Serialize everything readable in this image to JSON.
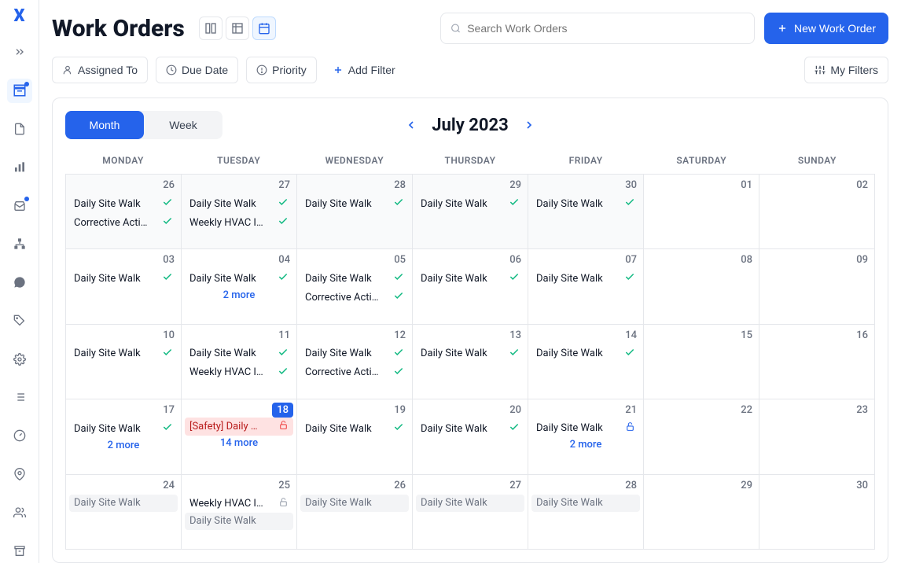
{
  "page": {
    "title": "Work Orders",
    "search_placeholder": "Search Work Orders",
    "new_button": "New Work Order"
  },
  "filters": {
    "assigned_to": "Assigned To",
    "due_date": "Due Date",
    "priority": "Priority",
    "add_filter": "Add Filter",
    "my_filters": "My Filters"
  },
  "calendar_ctrl": {
    "month_tab": "Month",
    "week_tab": "Week",
    "label": "July 2023",
    "days": [
      "MONDAY",
      "TUESDAY",
      "WEDNESDAY",
      "THURSDAY",
      "FRIDAY",
      "SATURDAY",
      "SUNDAY"
    ]
  },
  "cells": [
    {
      "date": "26",
      "outside": true,
      "events": [
        {
          "t": "Daily Site Walk",
          "s": "check"
        },
        {
          "t": "Corrective Acti…",
          "s": "check"
        }
      ]
    },
    {
      "date": "27",
      "outside": true,
      "events": [
        {
          "t": "Daily Site Walk",
          "s": "check"
        },
        {
          "t": "Weekly HVAC I…",
          "s": "check"
        }
      ]
    },
    {
      "date": "28",
      "outside": true,
      "events": [
        {
          "t": "Daily Site Walk",
          "s": "check"
        }
      ]
    },
    {
      "date": "29",
      "outside": true,
      "events": [
        {
          "t": "Daily Site Walk",
          "s": "check"
        }
      ]
    },
    {
      "date": "30",
      "outside": true,
      "events": [
        {
          "t": "Daily Site Walk",
          "s": "check"
        }
      ]
    },
    {
      "date": "01",
      "outside": false,
      "events": []
    },
    {
      "date": "02",
      "outside": false,
      "events": []
    },
    {
      "date": "03",
      "outside": false,
      "events": [
        {
          "t": "Daily Site Walk",
          "s": "check"
        }
      ]
    },
    {
      "date": "04",
      "outside": false,
      "events": [
        {
          "t": "Daily Site Walk",
          "s": "check"
        }
      ],
      "more": "2 more"
    },
    {
      "date": "05",
      "outside": false,
      "events": [
        {
          "t": "Daily Site Walk",
          "s": "check"
        },
        {
          "t": "Corrective Acti…",
          "s": "check"
        }
      ]
    },
    {
      "date": "06",
      "outside": false,
      "events": [
        {
          "t": "Daily Site Walk",
          "s": "check"
        }
      ]
    },
    {
      "date": "07",
      "outside": false,
      "events": [
        {
          "t": "Daily Site Walk",
          "s": "check"
        }
      ]
    },
    {
      "date": "08",
      "outside": false,
      "events": []
    },
    {
      "date": "09",
      "outside": false,
      "events": []
    },
    {
      "date": "10",
      "outside": false,
      "events": [
        {
          "t": "Daily Site Walk",
          "s": "check"
        }
      ]
    },
    {
      "date": "11",
      "outside": false,
      "events": [
        {
          "t": "Daily Site Walk",
          "s": "check"
        },
        {
          "t": "Weekly HVAC I…",
          "s": "check"
        }
      ]
    },
    {
      "date": "12",
      "outside": false,
      "events": [
        {
          "t": "Daily Site Walk",
          "s": "check"
        },
        {
          "t": "Corrective Acti…",
          "s": "check"
        }
      ]
    },
    {
      "date": "13",
      "outside": false,
      "events": [
        {
          "t": "Daily Site Walk",
          "s": "check"
        }
      ]
    },
    {
      "date": "14",
      "outside": false,
      "events": [
        {
          "t": "Daily Site Walk",
          "s": "check"
        }
      ]
    },
    {
      "date": "15",
      "outside": false,
      "events": []
    },
    {
      "date": "16",
      "outside": false,
      "events": []
    },
    {
      "date": "17",
      "outside": false,
      "events": [
        {
          "t": "Daily Site Walk",
          "s": "check"
        }
      ],
      "more": "2 more"
    },
    {
      "date": "18",
      "outside": false,
      "today": true,
      "events": [
        {
          "t": "[Safety] Daily …",
          "s": "lock-red",
          "style": "safety"
        }
      ],
      "more": "14 more"
    },
    {
      "date": "19",
      "outside": false,
      "events": [
        {
          "t": "Daily Site Walk",
          "s": "check"
        }
      ]
    },
    {
      "date": "20",
      "outside": false,
      "events": [
        {
          "t": "Daily Site Walk",
          "s": "check"
        }
      ]
    },
    {
      "date": "21",
      "outside": false,
      "events": [
        {
          "t": "Daily Site Walk",
          "s": "lock-blue"
        }
      ],
      "more": "2 more"
    },
    {
      "date": "22",
      "outside": false,
      "events": []
    },
    {
      "date": "23",
      "outside": false,
      "events": []
    },
    {
      "date": "24",
      "outside": false,
      "events": [
        {
          "t": "Daily Site Walk",
          "s": "none",
          "style": "faded"
        }
      ]
    },
    {
      "date": "25",
      "outside": false,
      "events": [
        {
          "t": "Weekly HVAC I…",
          "s": "lock-gray"
        },
        {
          "t": "Daily Site Walk",
          "s": "none",
          "style": "faded"
        }
      ]
    },
    {
      "date": "26",
      "outside": false,
      "events": [
        {
          "t": "Daily Site Walk",
          "s": "none",
          "style": "faded"
        }
      ]
    },
    {
      "date": "27",
      "outside": false,
      "events": [
        {
          "t": "Daily Site Walk",
          "s": "none",
          "style": "faded"
        }
      ]
    },
    {
      "date": "28",
      "outside": false,
      "events": [
        {
          "t": "Daily Site Walk",
          "s": "none",
          "style": "faded"
        }
      ]
    },
    {
      "date": "29",
      "outside": false,
      "events": []
    },
    {
      "date": "30",
      "outside": false,
      "events": []
    }
  ]
}
